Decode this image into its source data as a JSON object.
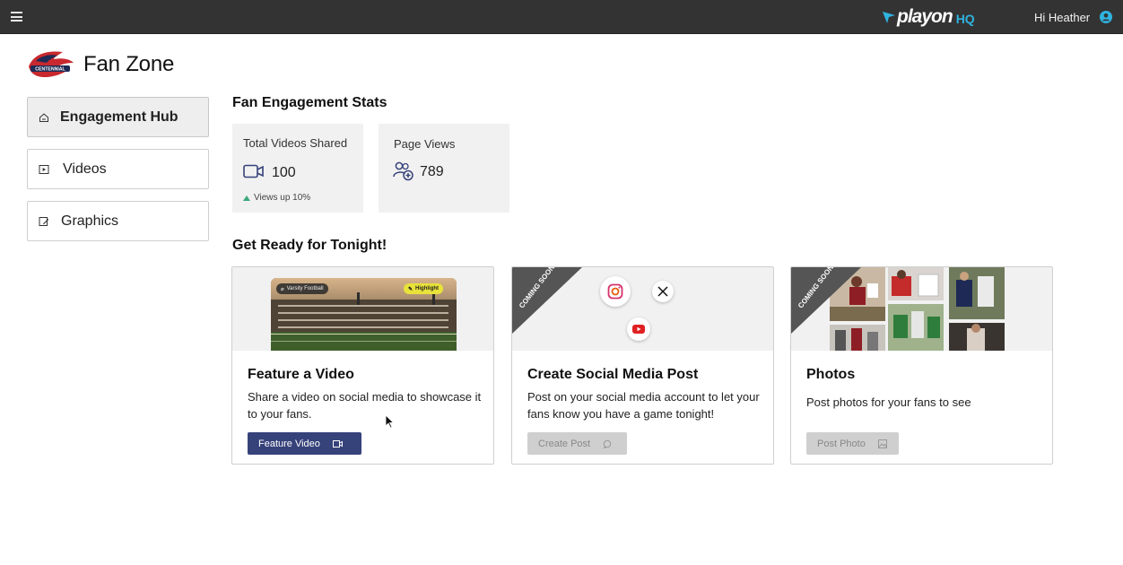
{
  "topbar": {
    "logo_word": "playon",
    "logo_suffix": "HQ",
    "greeting": "Hi Heather"
  },
  "brand": {
    "title": "Fan Zone",
    "crest_text": "CENTENNIAL"
  },
  "sidebar": {
    "items": [
      {
        "label": "Engagement Hub",
        "icon": "home-icon",
        "active": true
      },
      {
        "label": "Videos",
        "icon": "play-icon",
        "active": false
      },
      {
        "label": "Graphics",
        "icon": "graphics-icon",
        "active": false
      }
    ]
  },
  "stats": {
    "title": "Fan Engagement Stats",
    "items": [
      {
        "label": "Total Videos Shared",
        "value": "100",
        "trend": "Views up 10%",
        "icon": "video-camera-icon"
      },
      {
        "label": "Page Views",
        "value": "789",
        "icon": "users-icon"
      }
    ]
  },
  "ready": {
    "title": "Get Ready for Tonight!",
    "cards": [
      {
        "title": "Feature a Video",
        "description": "Share a video on social media to showcase it to your fans.",
        "button": "Feature Video",
        "button_enabled": true,
        "media_tag": "Varsity Football",
        "media_badge": "Highlight"
      },
      {
        "title": "Create Social Media Post",
        "description": "Post on your social media account to let your fans know you have a game tonight!",
        "button": "Create Post",
        "button_enabled": false,
        "ribbon": "COMING SOON!"
      },
      {
        "title": "Photos",
        "description": "Post photos for your fans to see",
        "button": "Post Photo",
        "button_enabled": false,
        "ribbon": "COMING SOON!"
      }
    ]
  },
  "colors": {
    "topbar": "#333333",
    "primary_button": "#36427a",
    "accent": "#2fb3e0",
    "trend_up": "#3aa87a",
    "ribbon": "#555555"
  }
}
